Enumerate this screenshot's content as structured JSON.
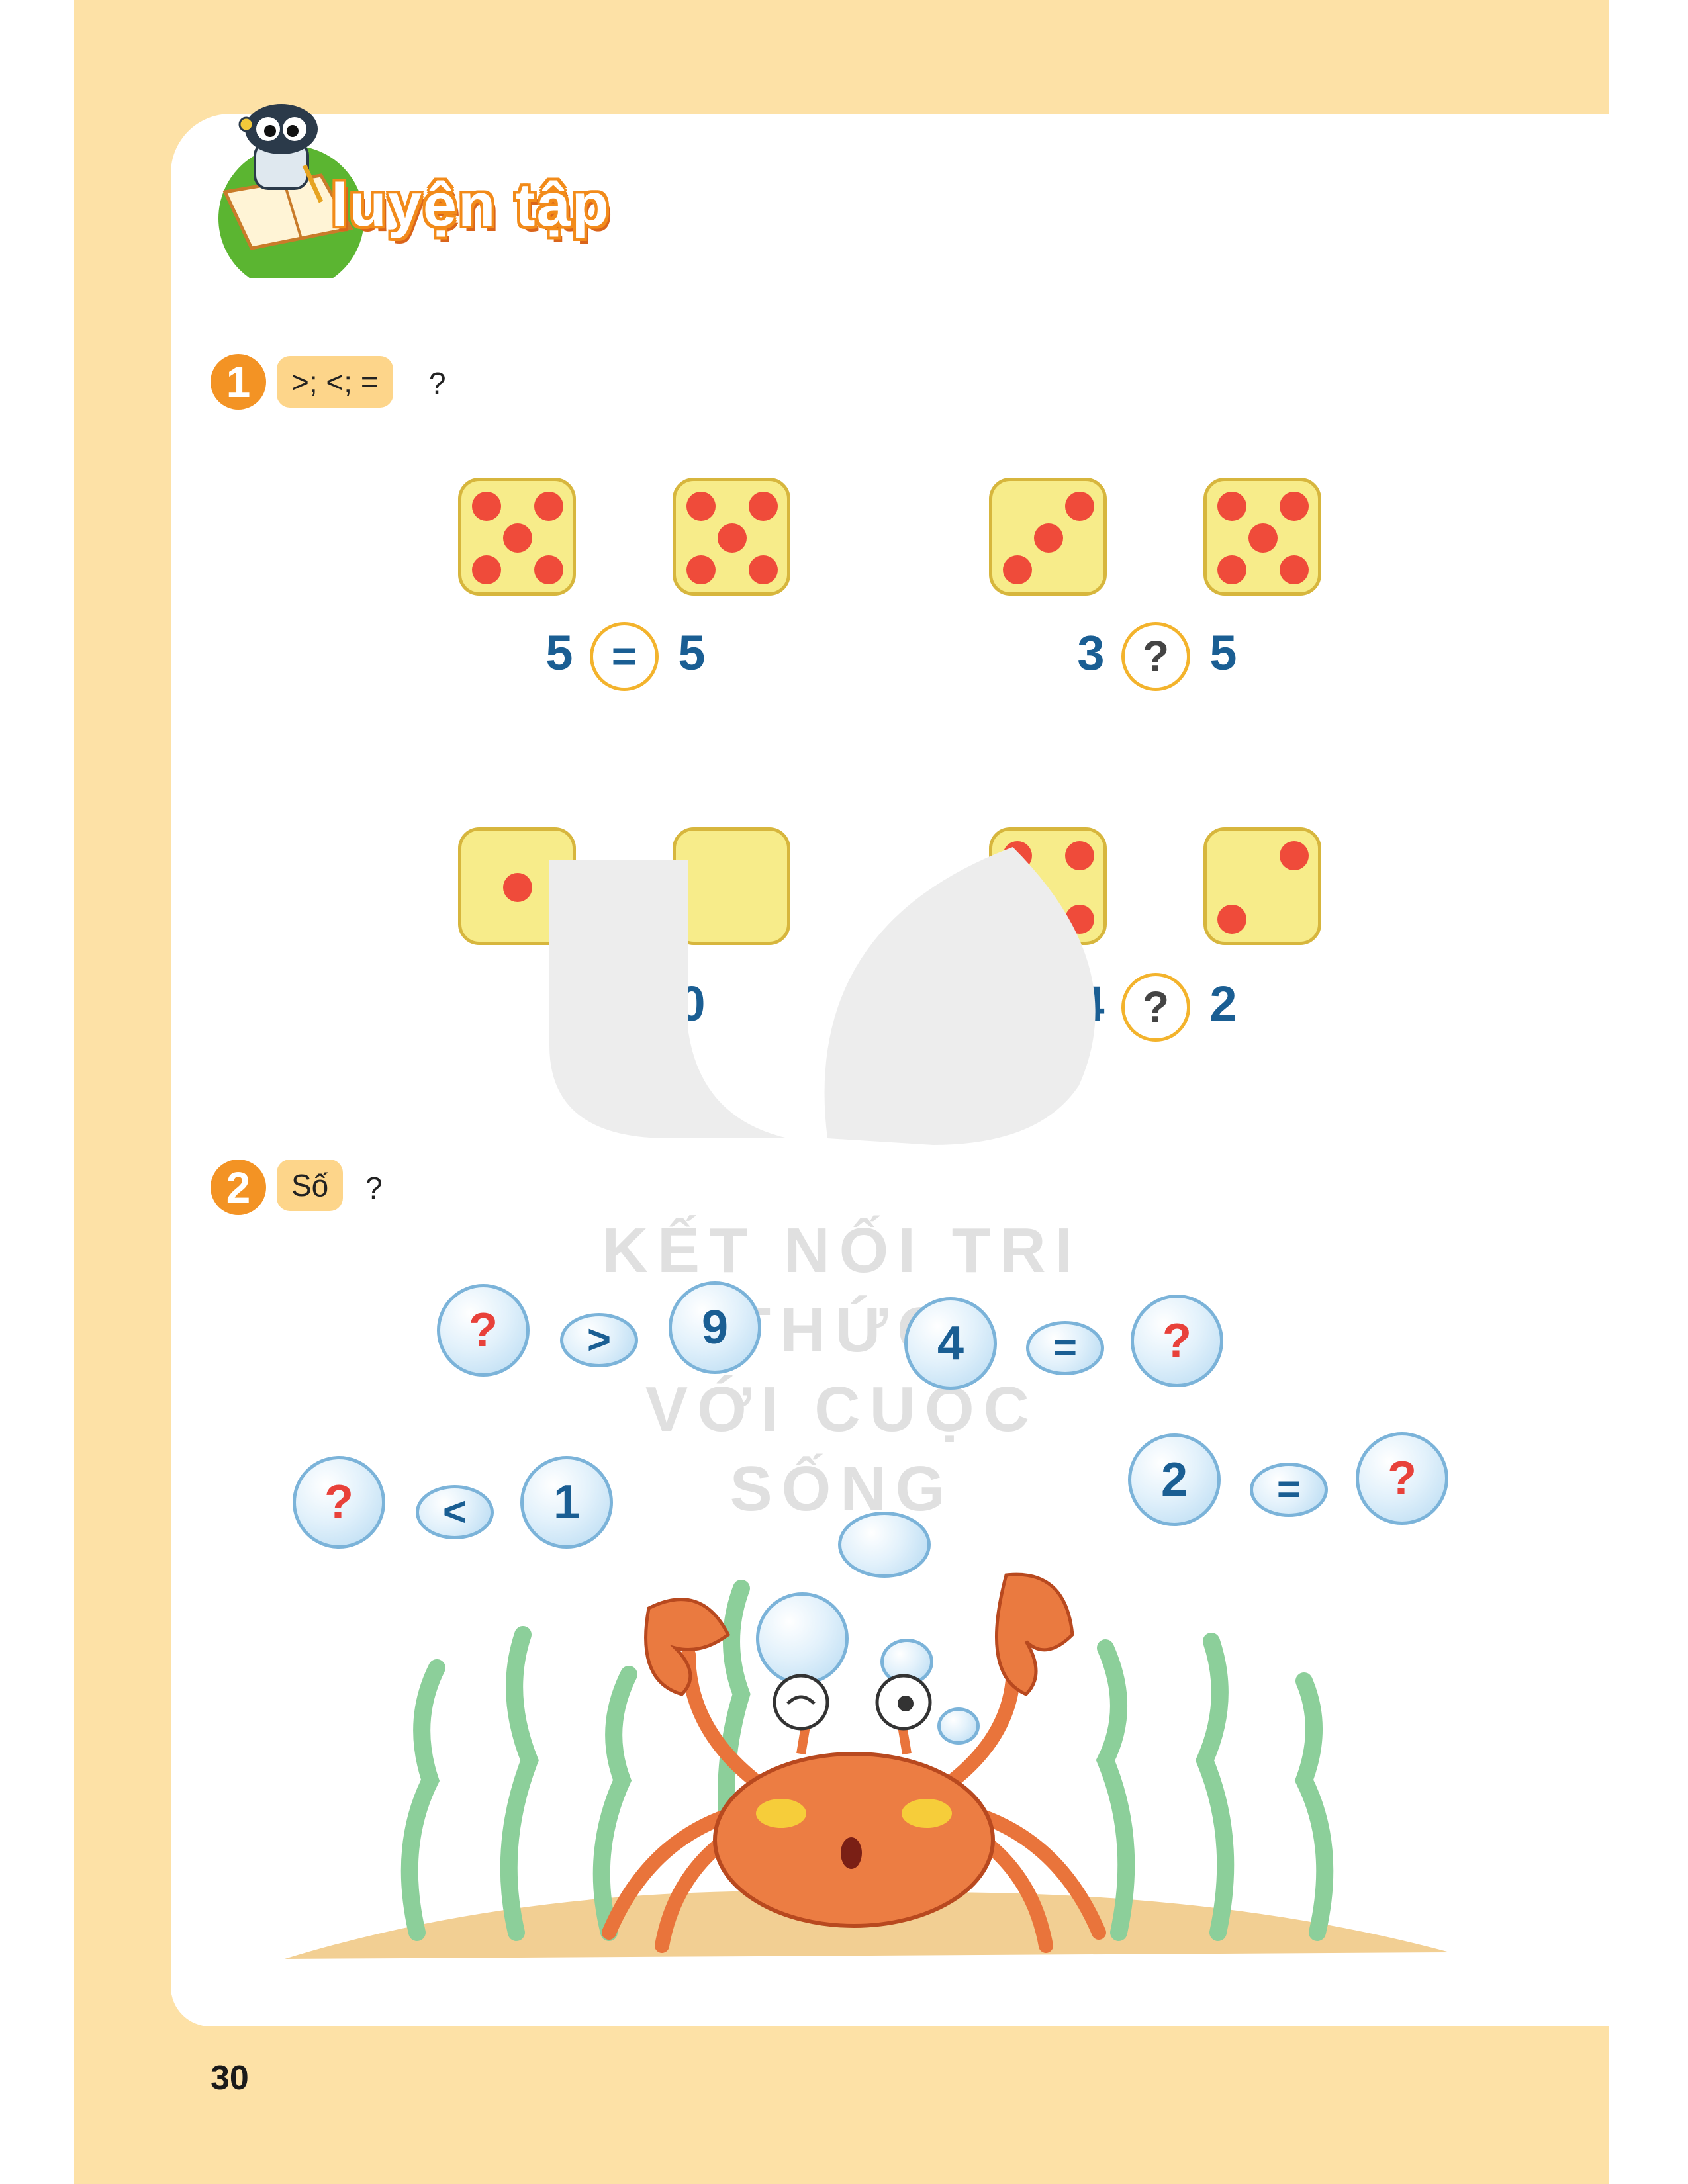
{
  "header": {
    "title": "luyện tập",
    "mascot_icon": "robot-reading-book-icon"
  },
  "exercise1": {
    "number": "1",
    "instruction": ">; <; =",
    "question_mark": "?",
    "items": [
      {
        "left_value": "5",
        "sign": "=",
        "right_value": "5",
        "left_dots": 5,
        "right_dots": 5
      },
      {
        "left_value": "3",
        "sign": "?",
        "right_value": "5",
        "left_dots": 3,
        "right_dots": 5
      },
      {
        "left_value": "1",
        "sign": "?",
        "right_value": "0",
        "left_dots": 1,
        "right_dots": 0
      },
      {
        "left_value": "4",
        "sign": "?",
        "right_value": "2",
        "left_dots": 4,
        "right_dots": 2
      }
    ]
  },
  "exercise2": {
    "number": "2",
    "instruction": "Số",
    "question_mark": "?",
    "rows": [
      {
        "left": "?",
        "sign": ">",
        "right": "9"
      },
      {
        "left": "4",
        "sign": "=",
        "right": "?"
      },
      {
        "left": "?",
        "sign": "<",
        "right": "1"
      },
      {
        "left": "2",
        "sign": "=",
        "right": "?"
      }
    ]
  },
  "watermark": {
    "line1": "KẾT NỐI TRI THỨC",
    "line2": "VỚI CUỘC SỐNG"
  },
  "page_number": "30",
  "colors": {
    "page_bg": "#fde1a6",
    "accent_orange": "#f39324",
    "number_blue": "#1a5e93",
    "dot_red": "#ef4b3a"
  }
}
